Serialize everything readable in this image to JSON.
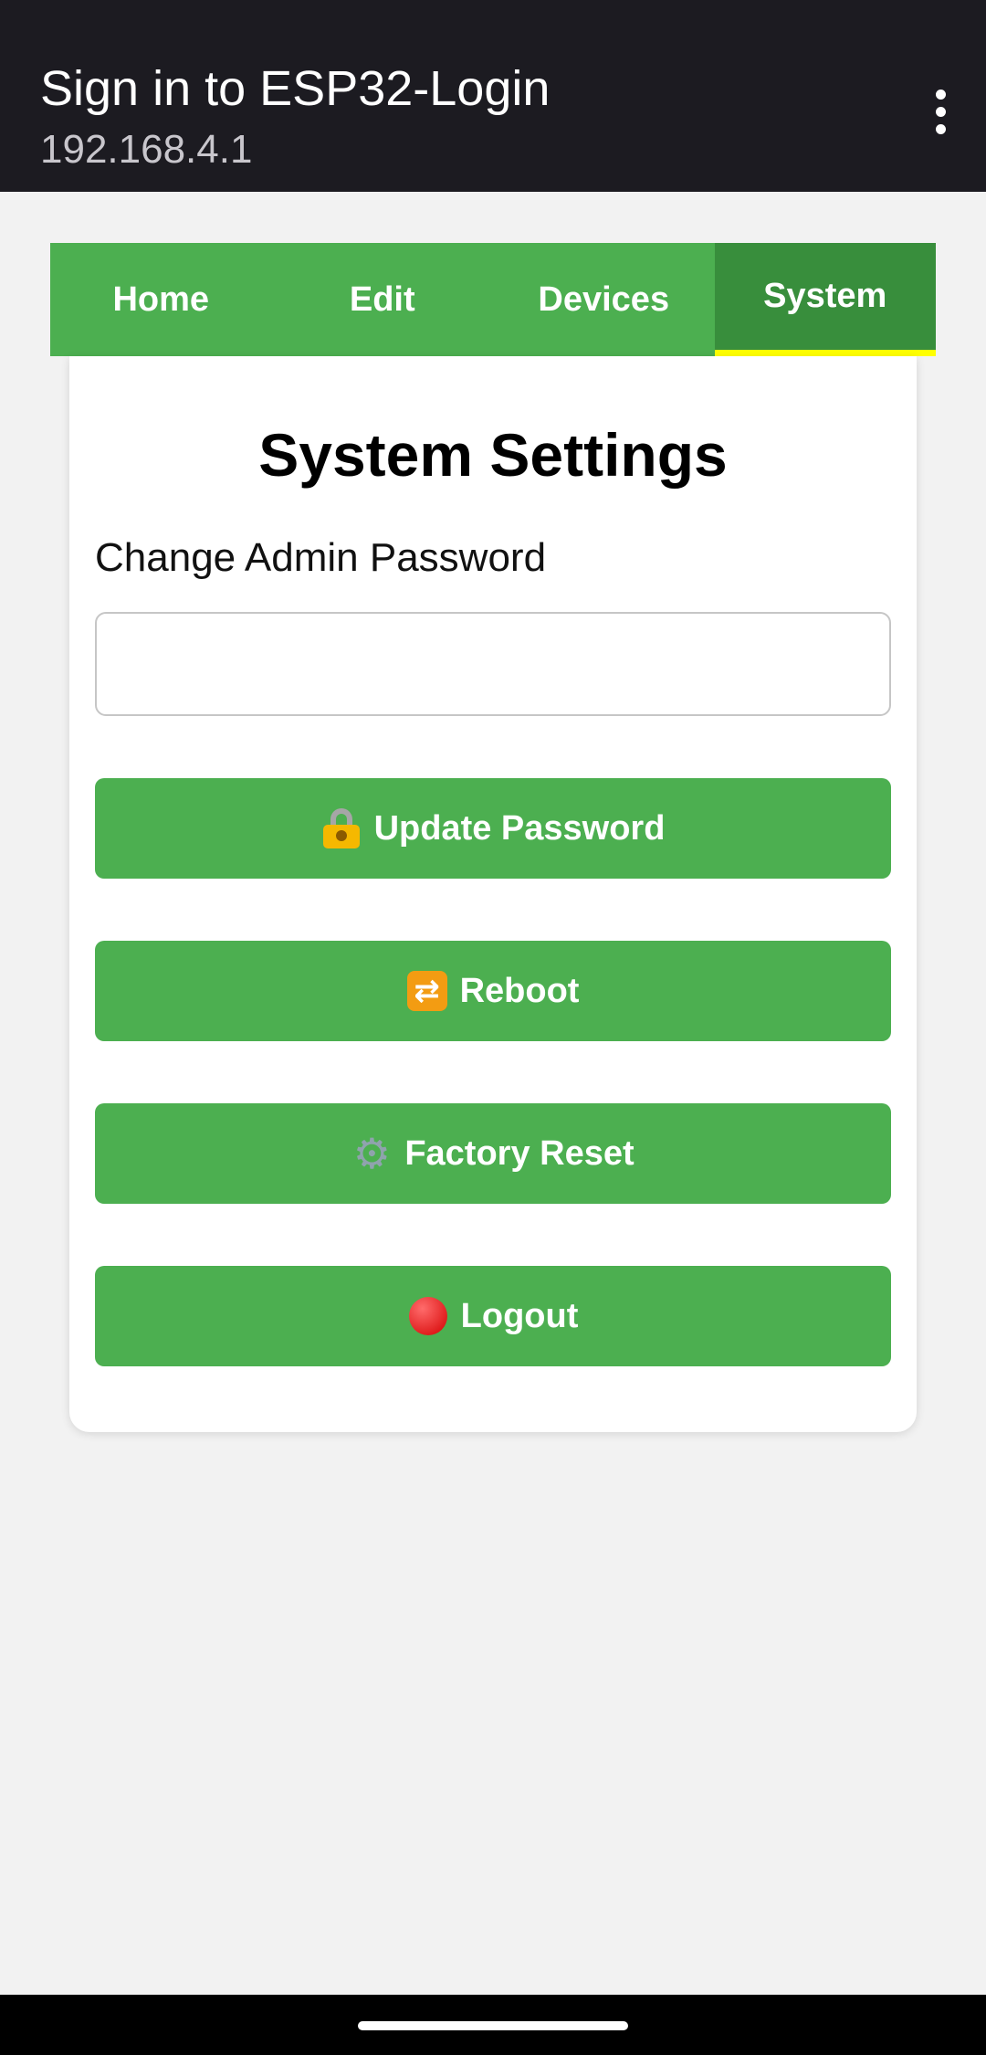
{
  "topbar": {
    "title": "Sign in to ESP32-Login",
    "subtitle": "192.168.4.1"
  },
  "nav": {
    "tabs": [
      {
        "label": "Home"
      },
      {
        "label": "Edit"
      },
      {
        "label": "Devices"
      },
      {
        "label": "System"
      }
    ],
    "active": "System"
  },
  "card": {
    "title": "System Settings",
    "password_label": "Change Admin Password",
    "password_value": "",
    "buttons": {
      "update_password": "Update Password",
      "reboot": "Reboot",
      "factory_reset": "Factory Reset",
      "logout": "Logout"
    }
  },
  "icons": {
    "update_password": "lock-with-key-icon",
    "reboot": "repeat-icon",
    "factory_reset": "gear-icon",
    "logout": "red-circle-icon"
  },
  "colors": {
    "accent": "#4caf50",
    "accent_active": "#388e3c",
    "active_underline": "#ffff00",
    "topbar_bg": "#1c1b21",
    "page_bg": "#f2f2f2"
  }
}
